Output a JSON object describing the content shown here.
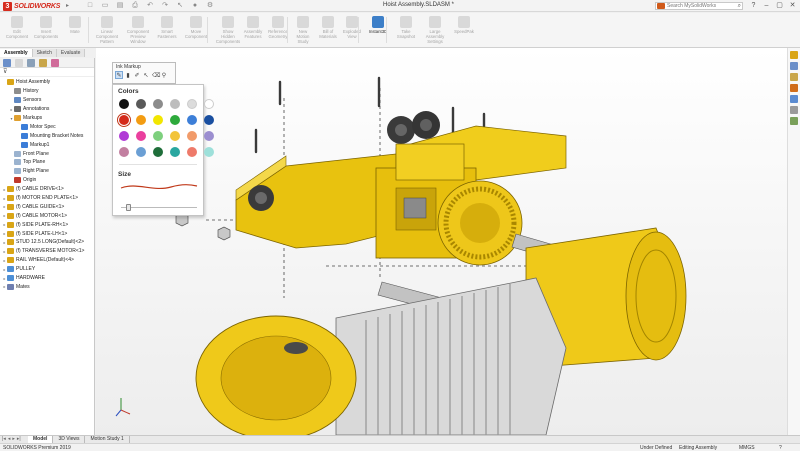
{
  "app": {
    "logo_text": "SOLIDWORKS",
    "document_title": "Hoist Assembly.SLDASM *",
    "search_placeholder": "Search MySolidWorks",
    "brand_color": "#d52b1e",
    "window_controls": [
      "minimize",
      "restore",
      "close"
    ]
  },
  "ribbon": {
    "tools": [
      {
        "label": "Edit\nComponent",
        "icon": "edit-component-icon",
        "enabled": false
      },
      {
        "label": "Insert\nComponents",
        "icon": "insert-components-icon",
        "enabled": false
      },
      {
        "label": "Mate",
        "icon": "mate-icon",
        "enabled": false
      },
      {
        "label": "Linear Component\nPattern",
        "icon": "linear-pattern-icon",
        "enabled": false
      },
      {
        "label": "Component\nPreview\nWindow",
        "icon": "preview-window-icon",
        "enabled": false
      },
      {
        "label": "Smart\nFasteners",
        "icon": "smart-fasteners-icon",
        "enabled": false
      },
      {
        "label": "Move\nComponent",
        "icon": "move-component-icon",
        "enabled": false
      },
      {
        "label": "Show\nHidden\nComponents",
        "icon": "show-hidden-icon",
        "enabled": false
      },
      {
        "label": "Assembly\nFeatures",
        "icon": "assembly-features-icon",
        "enabled": false
      },
      {
        "label": "Reference\nGeometry",
        "icon": "reference-geometry-icon",
        "enabled": false
      },
      {
        "label": "New\nMotion\nStudy",
        "icon": "motion-study-icon",
        "enabled": false
      },
      {
        "label": "Bill of\nMaterials",
        "icon": "bom-icon",
        "enabled": false
      },
      {
        "label": "Exploded\nView",
        "icon": "exploded-view-icon",
        "enabled": false
      },
      {
        "label": "Instant3D",
        "icon": "instant3d-icon",
        "enabled": true
      },
      {
        "label": "Take\nSnapshot",
        "icon": "snapshot-icon",
        "enabled": false
      },
      {
        "label": "Large\nAssembly\nSettings",
        "icon": "large-assembly-icon",
        "enabled": false
      },
      {
        "label": "SpeedPak",
        "icon": "speedpak-icon",
        "enabled": false
      }
    ],
    "tabs": [
      {
        "label": "Assembly",
        "active": true
      },
      {
        "label": "Sketch",
        "active": false
      },
      {
        "label": "Evaluate",
        "active": false
      }
    ]
  },
  "feature_tree": {
    "items": [
      {
        "label": "Hoist Assembly",
        "icon": "assembly-icon",
        "color": "#d9a516",
        "indent": 0,
        "toggle": ""
      },
      {
        "label": "History",
        "icon": "history-icon",
        "color": "#8d8d8d",
        "indent": 1,
        "toggle": ""
      },
      {
        "label": "Sensors",
        "icon": "sensors-icon",
        "color": "#5f88c2",
        "indent": 1,
        "toggle": ""
      },
      {
        "label": "Annotations",
        "icon": "annotations-icon",
        "color": "#6b6b6b",
        "indent": 1,
        "toggle": ">"
      },
      {
        "label": "Markups",
        "icon": "markups-icon",
        "color": "#e0a030",
        "indent": 1,
        "toggle": "v"
      },
      {
        "label": "Motor Spec",
        "icon": "markup-icon",
        "color": "#3b7dd8",
        "indent": 2,
        "toggle": ""
      },
      {
        "label": "Mounting Bracket Notes",
        "icon": "markup-icon",
        "color": "#3b7dd8",
        "indent": 2,
        "toggle": ""
      },
      {
        "label": "Markup1",
        "icon": "markup-icon",
        "color": "#3b7dd8",
        "indent": 2,
        "toggle": ""
      },
      {
        "label": "Front Plane",
        "icon": "plane-icon",
        "color": "#9bb3cf",
        "indent": 1,
        "toggle": ""
      },
      {
        "label": "Top Plane",
        "icon": "plane-icon",
        "color": "#9bb3cf",
        "indent": 1,
        "toggle": ""
      },
      {
        "label": "Right Plane",
        "icon": "plane-icon",
        "color": "#9bb3cf",
        "indent": 1,
        "toggle": ""
      },
      {
        "label": "Origin",
        "icon": "origin-icon",
        "color": "#c0392b",
        "indent": 1,
        "toggle": ""
      },
      {
        "label": "(f) CABLE DRIVE<1>",
        "icon": "part-icon",
        "color": "#d9a516",
        "indent": 0,
        "toggle": ">"
      },
      {
        "label": "(f) MOTOR END PLATE<1>",
        "icon": "part-icon",
        "color": "#d9a516",
        "indent": 0,
        "toggle": ">"
      },
      {
        "label": "(f) CABLE GUIDE<1>",
        "icon": "part-icon",
        "color": "#d9a516",
        "indent": 0,
        "toggle": ">"
      },
      {
        "label": "(f) CABLE MOTOR<1>",
        "icon": "part-icon",
        "color": "#d9a516",
        "indent": 0,
        "toggle": ">"
      },
      {
        "label": "(f) SIDE PLATE-RH<1>",
        "icon": "part-icon",
        "color": "#d9a516",
        "indent": 0,
        "toggle": ">"
      },
      {
        "label": "(f) SIDE PLATE-LH<1>",
        "icon": "part-icon",
        "color": "#d9a516",
        "indent": 0,
        "toggle": ">"
      },
      {
        "label": "STUD 12.5 LONG(Default)<2>",
        "icon": "part-icon",
        "color": "#d9a516",
        "indent": 0,
        "toggle": ">"
      },
      {
        "label": "(f) TRANSVERSE MOTOR<1>",
        "icon": "part-icon",
        "color": "#d9a516",
        "indent": 0,
        "toggle": ">"
      },
      {
        "label": "RAIL WHEEL(Default)<4>",
        "icon": "part-icon",
        "color": "#d9a516",
        "indent": 0,
        "toggle": ">"
      },
      {
        "label": "PULLEY",
        "icon": "folder-icon",
        "color": "#4d8fd6",
        "indent": 0,
        "toggle": ">"
      },
      {
        "label": "HARDWARE",
        "icon": "folder-icon",
        "color": "#4d8fd6",
        "indent": 0,
        "toggle": ">"
      },
      {
        "label": "Mates",
        "icon": "mates-icon",
        "color": "#6f7fb0",
        "indent": 0,
        "toggle": ">"
      }
    ]
  },
  "ink_markup": {
    "title": "Ink Markup",
    "tools": [
      "pen-icon",
      "marker-icon",
      "highlighter-icon",
      "pointer-icon",
      "eraser-icon",
      "lasso-icon"
    ],
    "colors_heading": "Colors",
    "colors": [
      "#111111",
      "#595959",
      "#8c8c8c",
      "#bdbdbd",
      "#dcdcdc",
      "#ffffff",
      "#d42a1a",
      "#f39c12",
      "#f2e600",
      "#2eaa3c",
      "#3d7fd8",
      "#1a4fa0",
      "#b039d6",
      "#ea3f9e",
      "#7ed07e",
      "#f2c43a",
      "#f19b6a",
      "#9c8fd0",
      "#c27fa0",
      "#6b9fd4",
      "#1f6e3a",
      "#2aa7a0",
      "#ee7a6a",
      "#9ee0da"
    ],
    "selected_color": "#d42a1a",
    "size_heading": "Size",
    "stroke_color": "#c0391a",
    "size_value": 0.07
  },
  "bottom_tabs": [
    {
      "label": "Model",
      "active": true
    },
    {
      "label": "3D Views",
      "active": false
    },
    {
      "label": "Motion Study 1",
      "active": false
    }
  ],
  "status": {
    "product": "SOLIDWORKS Premium 2019",
    "state": "Under Defined",
    "mode": "Editing Assembly",
    "units": "MMGS"
  }
}
